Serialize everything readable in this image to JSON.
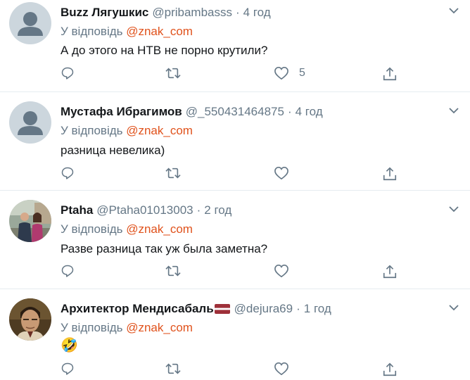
{
  "tweets": [
    {
      "name": "Buzz Лягушкис",
      "handle": "@pribambasss",
      "sep": "·",
      "time": "4 год",
      "reply_prefix": "У відповідь",
      "reply_to": "@znak_com",
      "text": "А до этого на НТВ не порно крутили?",
      "like_count": "5",
      "avatar": "default"
    },
    {
      "name": "Мустафа Ибрагимов",
      "handle": "@_550431464875",
      "sep": "·",
      "time": "4 год",
      "reply_prefix": "У відповідь",
      "reply_to": "@znak_com",
      "text": "разница невелика)",
      "like_count": "",
      "avatar": "default"
    },
    {
      "name": "Ptaha",
      "handle": "@Ptaha01013003",
      "sep": "·",
      "time": "2 год",
      "reply_prefix": "У відповідь",
      "reply_to": "@znak_com",
      "text": "Разве разница так уж была заметна?",
      "like_count": "",
      "avatar": "photo-couple"
    },
    {
      "name": "Архитектор Мендисабаль",
      "handle": "@dejura69",
      "sep": "·",
      "time": "1 год",
      "reply_prefix": "У відповідь",
      "reply_to": "@znak_com",
      "text": "🤣",
      "like_count": "",
      "avatar": "photo-man",
      "name_flag": "latvia-flag"
    }
  ],
  "icons": {
    "reply": "reply-icon",
    "retweet": "retweet-icon",
    "like": "heart-icon",
    "share": "share-icon",
    "more": "chevron-down-icon"
  },
  "colors": {
    "mention": "#e0521c",
    "muted": "#657786",
    "text": "#14171a",
    "divider": "#e6ecf0"
  }
}
